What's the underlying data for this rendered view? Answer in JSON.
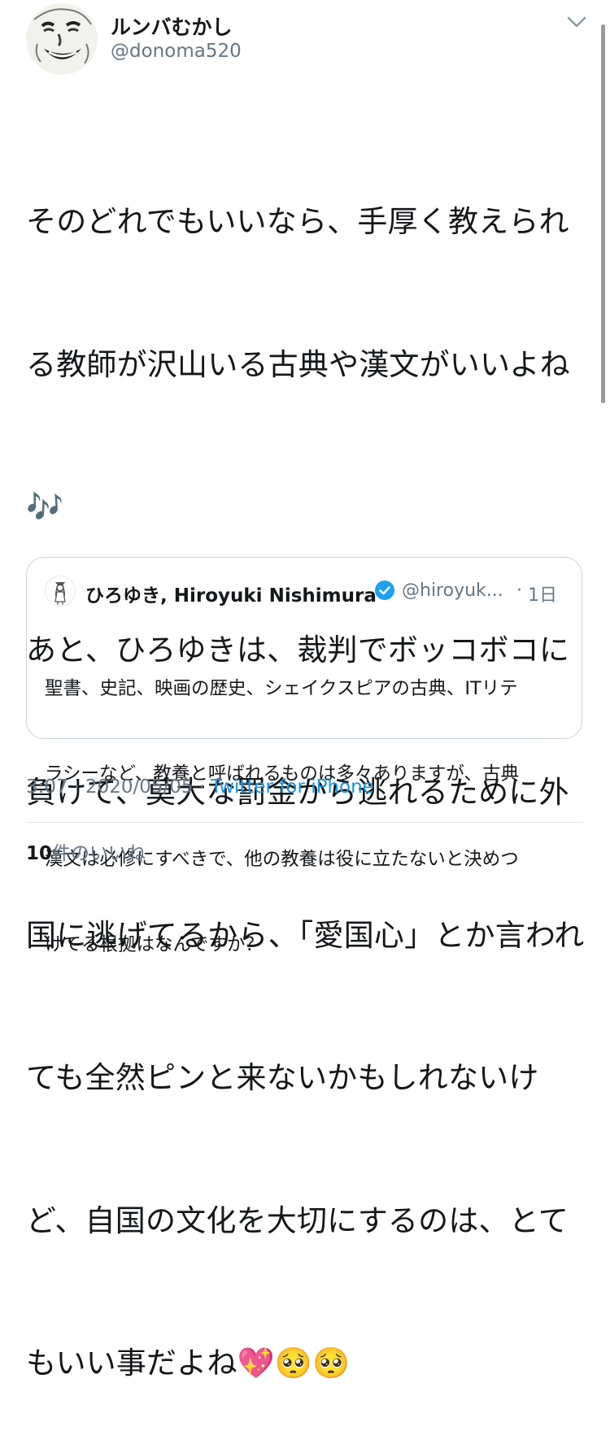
{
  "author": {
    "display_name": "ルンバむかし",
    "handle": "@donoma520",
    "avatar_icon": "smiling-face-drawing-avatar"
  },
  "menu_icon": "chevron-down-icon",
  "tweet": {
    "text_lines": [
      "そのどれでもいいなら、手厚く教えられ",
      "る教師が沢山いる古典や漢文がいいよね",
      "🎶",
      "あと、ひろゆきは、裁判でボッコボコに",
      "負けて、莫大な罰金から逃れるために外",
      "国に逃げてるから、「愛国心」とか言われ",
      "ても全然ピンと来ないかもしれないけ",
      "ど、自国の文化を大切にするのは、とて",
      "もいい事だよね💖🥺🥺"
    ]
  },
  "quoted_tweet": {
    "display_name": "ひろゆき, Hiroyuki Nishimura",
    "verified_icon": "verified-badge-icon",
    "handle": "@hiroyuk...",
    "separator": "·",
    "time": "1日",
    "text_lines": [
      "聖書、史記、映画の歴史、シェイクスピアの古典、ITリテ",
      "ラシーなど、教養と呼ばれるものは多々ありますが、古典",
      "漢文は必修にすべきで、他の教養は役に立たないと決めつ",
      "けてる根拠はなんですか？"
    ]
  },
  "meta": {
    "time": "3:07",
    "separator": "·",
    "date": "2020/05/05",
    "source": "Twitter for iPhone"
  },
  "likes": {
    "count": "10",
    "label": "件のいいね"
  },
  "colors": {
    "text": "#14171a",
    "secondary": "#657786",
    "link": "#1b95e0",
    "border": "#ccd6dd",
    "verified": "#1da1f2"
  }
}
